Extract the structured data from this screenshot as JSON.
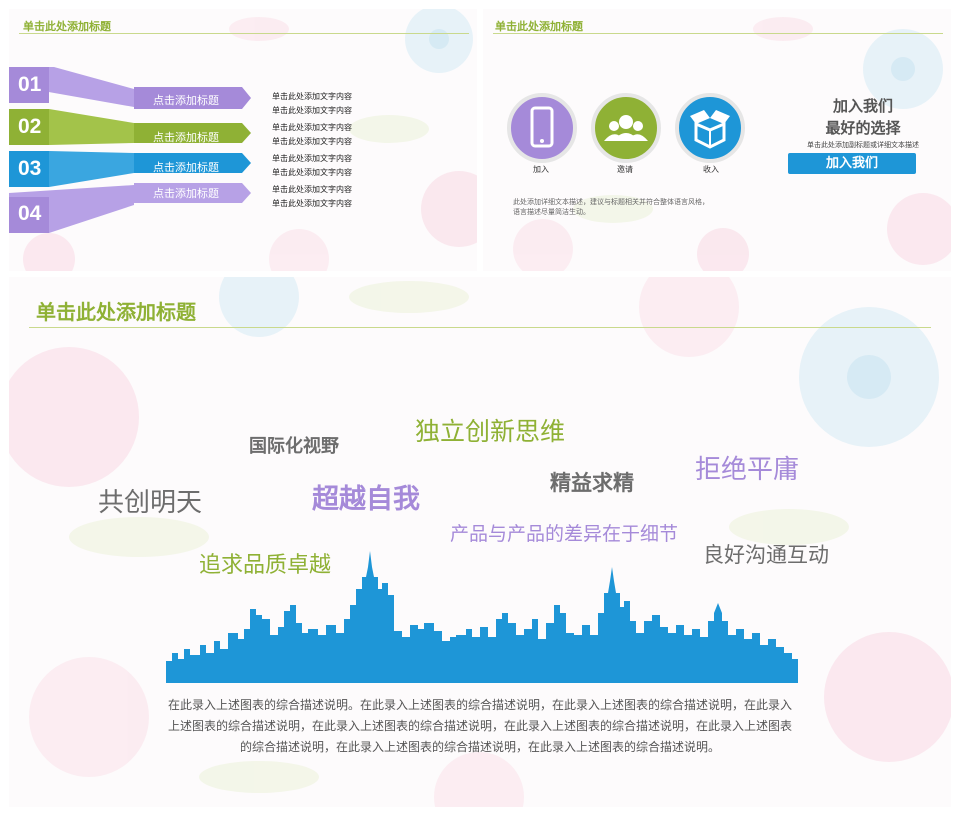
{
  "colors": {
    "green": "#8fb135",
    "purple": "#a58ad9",
    "blue": "#1e96d7",
    "gray": "#6d6d6d",
    "dark": "#555555"
  },
  "slide1": {
    "title": "单击此处添加标题",
    "items": [
      {
        "num": "01",
        "label": "点击添加标题",
        "text1": "单击此处添加文字内容",
        "text2": "单击此处添加文字内容"
      },
      {
        "num": "02",
        "label": "点击添加标题",
        "text1": "单击此处添加文字内容",
        "text2": "单击此处添加文字内容"
      },
      {
        "num": "03",
        "label": "点击添加标题",
        "text1": "单击此处添加文字内容",
        "text2": "单击此处添加文字内容"
      },
      {
        "num": "04",
        "label": "点击添加标题",
        "text1": "单击此处添加文字内容",
        "text2": "单击此处添加文字内容"
      }
    ]
  },
  "slide2": {
    "title": "单击此处添加标题",
    "icons": [
      {
        "icon": "smartphone-icon",
        "caption": "加入"
      },
      {
        "icon": "people-icon",
        "caption": "邀请"
      },
      {
        "icon": "box-icon",
        "caption": "收入"
      }
    ],
    "heading1": "加入我们",
    "heading2": "最好的选择",
    "subtitle": "单击此处添加副标题或详细文本描述",
    "button": "加入我们",
    "note1": "此处添加详细文本描述，建议与标题相关并符合整体语言风格，",
    "note2": "语言描述尽量简洁生动。"
  },
  "slide3": {
    "title": "单击此处添加标题",
    "words": [
      {
        "text": "国际化视野",
        "color": "#6d6d6d"
      },
      {
        "text": "独立创新思维",
        "color": "#8fb135"
      },
      {
        "text": "精益求精",
        "color": "#6d6d6d"
      },
      {
        "text": "拒绝平庸",
        "color": "#a58ad9"
      },
      {
        "text": "共创明天",
        "color": "#6d6d6d"
      },
      {
        "text": "超越自我",
        "color": "#a58ad9"
      },
      {
        "text": "产品与产品的差异在于细节",
        "color": "#a58ad9"
      },
      {
        "text": "良好沟通互动",
        "color": "#6d6d6d"
      },
      {
        "text": "追求品质卓越",
        "color": "#8fb135"
      }
    ],
    "skyline_icon": "city-skyline-icon",
    "desc_line1": "在此录入上述图表的综合描述说明。在此录入上述图表的综合描述说明，在此录入上述图表的综合描述说明，在此录入",
    "desc_line2": "上述图表的综合描述说明，在此录入上述图表的综合描述说明，在此录入上述图表的综合描述说明，在此录入上述图表",
    "desc_line3": "的综合描述说明，在此录入上述图表的综合描述说明，在此录入上述图表的综合描述说明。"
  }
}
